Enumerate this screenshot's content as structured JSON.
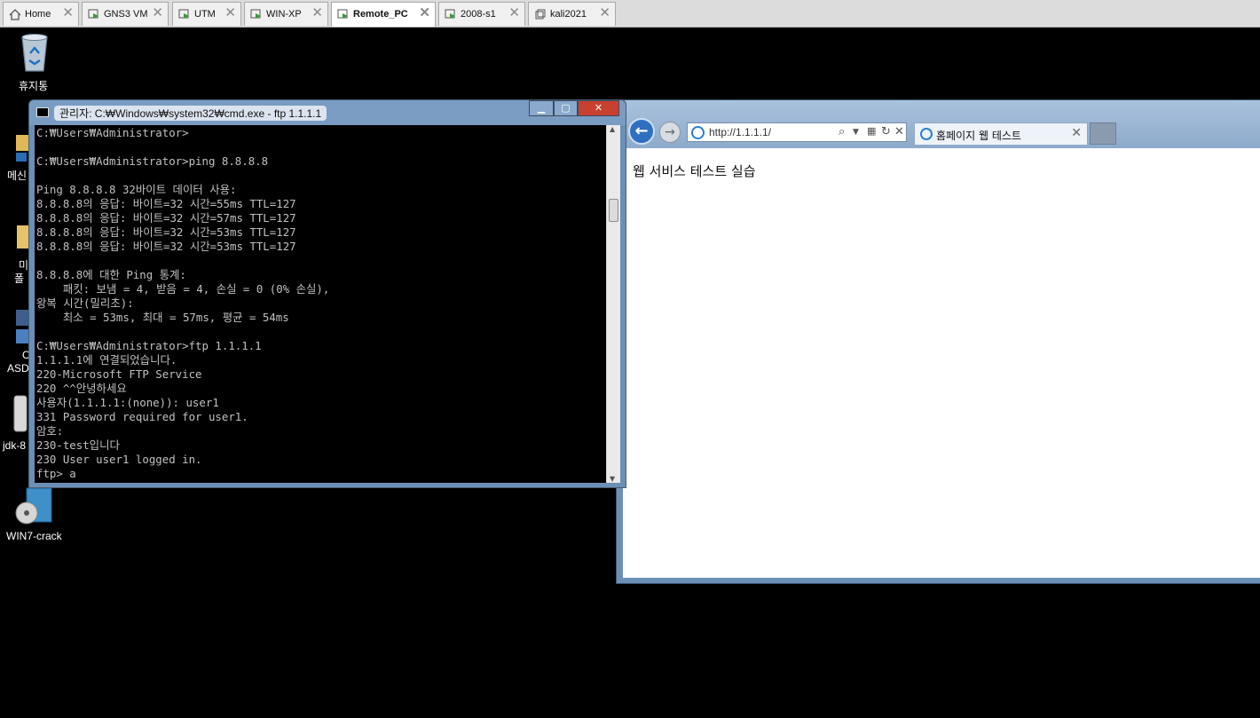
{
  "vm_tabs": [
    {
      "label": "Home",
      "icon": "home-icon",
      "active": false
    },
    {
      "label": "GNS3 VM",
      "icon": "vm-icon",
      "active": false
    },
    {
      "label": "UTM",
      "icon": "vm-icon",
      "active": false
    },
    {
      "label": "WIN-XP",
      "icon": "vm-icon",
      "active": false
    },
    {
      "label": "Remote_PC",
      "icon": "vm-icon",
      "active": true
    },
    {
      "label": "2008-s1",
      "icon": "vm-icon",
      "active": false
    },
    {
      "label": "kali2021",
      "icon": "vm-icon",
      "active": false
    }
  ],
  "desktop": {
    "recycle_bin": "휴지통",
    "partial_labels": [
      "메신",
      "미",
      "폴",
      "C",
      "ASD",
      "jdk-8"
    ],
    "win7_crack": "WIN7-crack"
  },
  "cmd": {
    "title": "관리자: C:₩Windows₩system32₩cmd.exe - ftp  1.1.1.1",
    "lines": [
      "C:₩Users₩Administrator>",
      "",
      "C:₩Users₩Administrator>ping 8.8.8.8",
      "",
      "Ping 8.8.8.8 32바이트 데이터 사용:",
      "8.8.8.8의 응답: 바이트=32 시간=55ms TTL=127",
      "8.8.8.8의 응답: 바이트=32 시간=57ms TTL=127",
      "8.8.8.8의 응답: 바이트=32 시간=53ms TTL=127",
      "8.8.8.8의 응답: 바이트=32 시간=53ms TTL=127",
      "",
      "8.8.8.8에 대한 Ping 통계:",
      "    패킷: 보냄 = 4, 받음 = 4, 손실 = 0 (0% 손실),",
      "왕복 시간(밀리초):",
      "    최소 = 53ms, 최대 = 57ms, 평균 = 54ms",
      "",
      "C:₩Users₩Administrator>ftp 1.1.1.1",
      "1.1.1.1에 연결되었습니다.",
      "220-Microsoft FTP Service",
      "220 ^^안녕하세요",
      "사용자(1.1.1.1:(none)): user1",
      "331 Password required for user1.",
      "암호:",
      "230-test입니다",
      "230 User user1 logged in.",
      "ftp> a"
    ]
  },
  "ie": {
    "url": "http://1.1.1.1/",
    "tab_title": "홈페이지 웹 테스트",
    "page_text": "웹 서비스 테스트 실습"
  }
}
